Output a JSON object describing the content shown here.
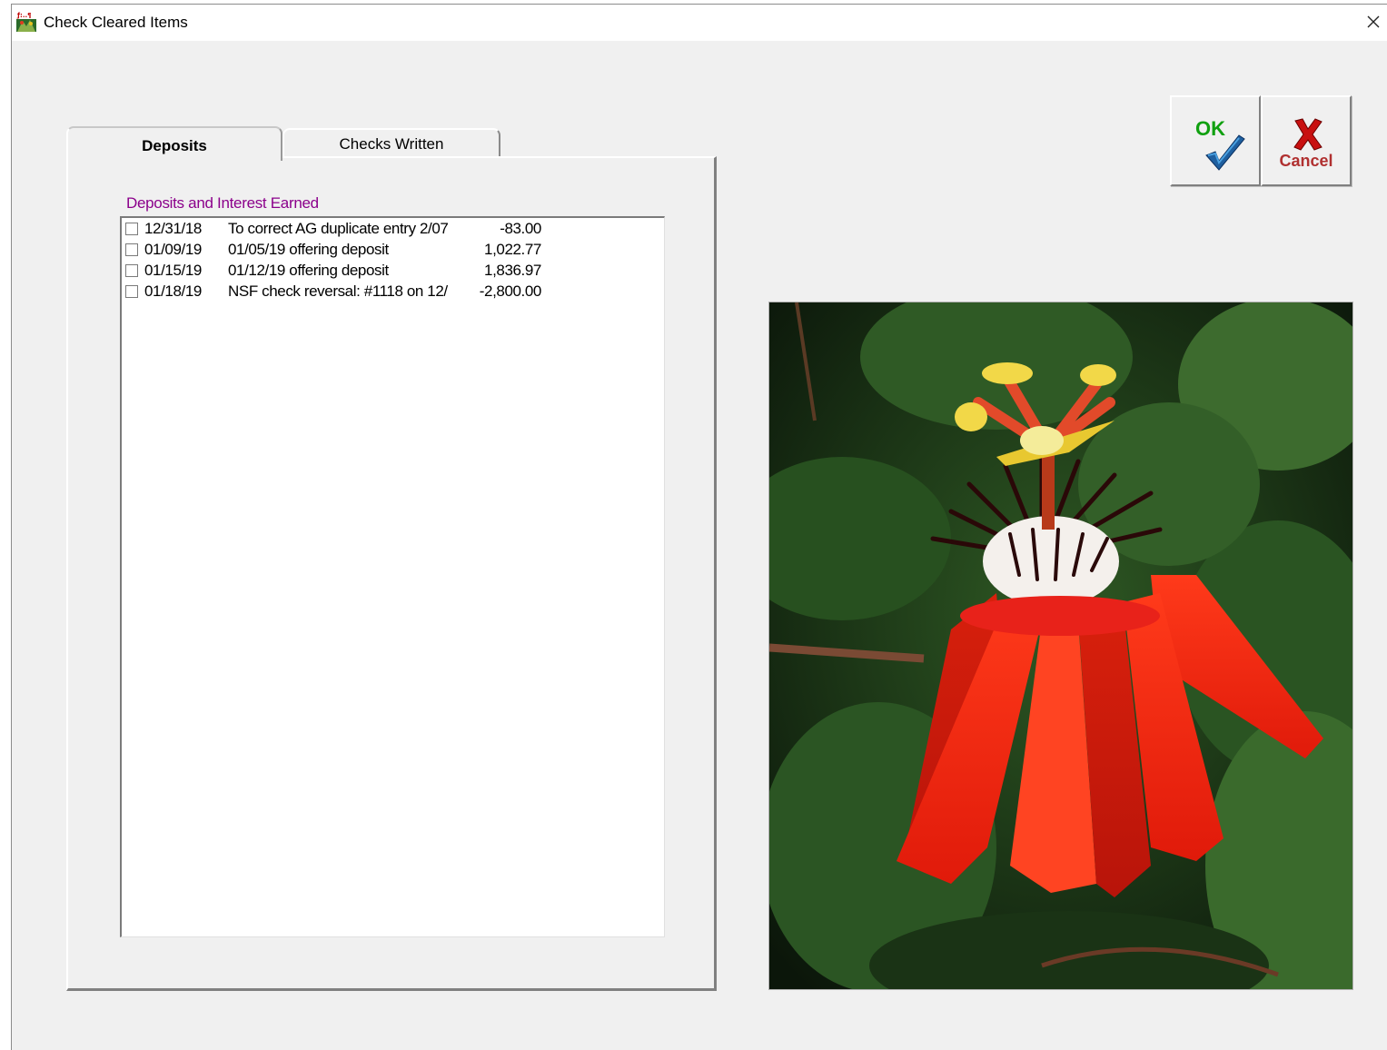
{
  "window": {
    "title": "Check Cleared Items"
  },
  "tabs": [
    {
      "label": "Deposits",
      "active": true
    },
    {
      "label": "Checks Written",
      "active": false
    }
  ],
  "deposits": {
    "caption": "Deposits and Interest Earned",
    "rows": [
      {
        "checked": false,
        "date": "12/31/18",
        "description": "To correct AG duplicate entry 2/07",
        "amount": "-83.00"
      },
      {
        "checked": false,
        "date": "01/09/19",
        "description": "01/05/19 offering deposit",
        "amount": "1,022.77"
      },
      {
        "checked": false,
        "date": "01/15/19",
        "description": "01/12/19 offering deposit",
        "amount": "1,836.97"
      },
      {
        "checked": false,
        "date": "01/18/19",
        "description": "NSF check reversal: #1118 on 12/",
        "amount": "-2,800.00"
      }
    ]
  },
  "buttons": {
    "ok_label": "OK",
    "cancel_label": "Cancel"
  },
  "colors": {
    "caption": "#8b008b",
    "ok": "#10a010",
    "cancel": "#b03030",
    "dialog_bg": "#f0f0f0"
  },
  "icons": {
    "app": "app-logo-icon",
    "close": "close-icon",
    "ok": "check-mark-icon",
    "cancel": "x-mark-icon"
  },
  "photo": {
    "subject": "red-passion-flower"
  }
}
